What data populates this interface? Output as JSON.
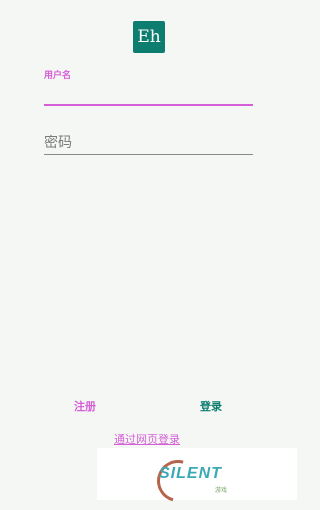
{
  "logo": {
    "text": "Eh"
  },
  "username": {
    "label": "用户名",
    "value": ""
  },
  "password": {
    "placeholder": "密码",
    "value": ""
  },
  "actions": {
    "register_label": "注册",
    "login_label": "登录",
    "web_login_label": "通过网页登录"
  },
  "watermark": {
    "text": "SILENT",
    "sub": "游戏"
  },
  "colors": {
    "accent": "#d45fd6",
    "brand": "#0d7d6f",
    "background": "#f5f7f5"
  }
}
